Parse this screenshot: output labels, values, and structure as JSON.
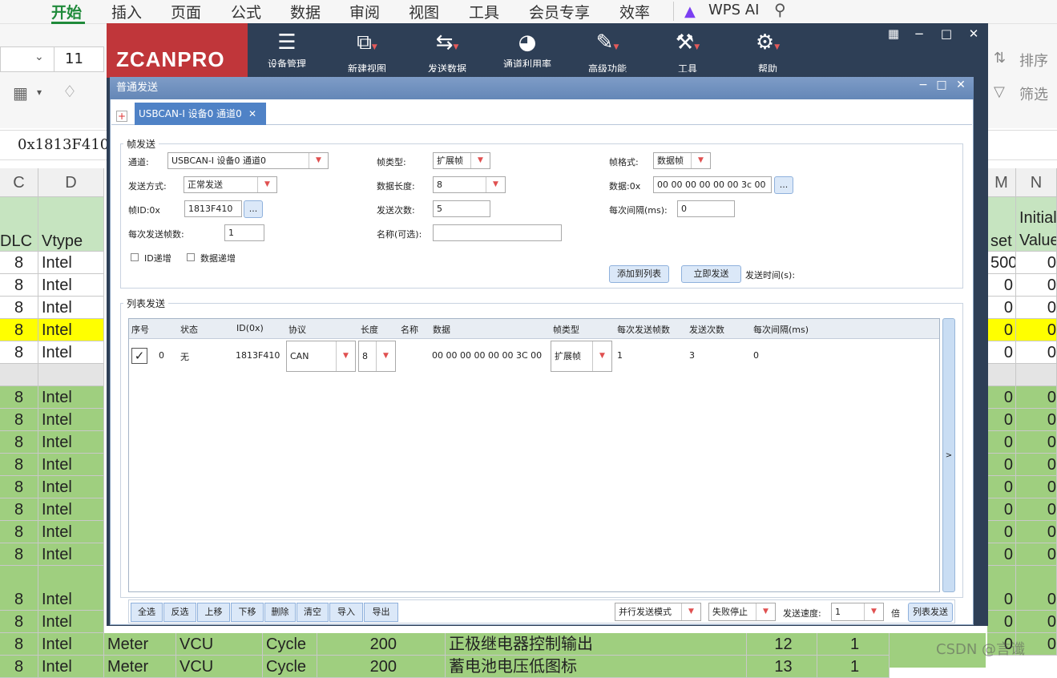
{
  "wps": {
    "menu": [
      "开始",
      "插入",
      "页面",
      "公式",
      "数据",
      "审阅",
      "视图",
      "工具",
      "会员专享",
      "效率"
    ],
    "ai_label": "WPS AI",
    "font_size": "11",
    "sort_label": "排序",
    "filter_label": "筛选",
    "formula": "0x1813F410",
    "col_headers": {
      "c": "C",
      "d": "D",
      "m": "M",
      "n": "N"
    },
    "hdr_row": {
      "c": "DLC",
      "d": "Vtype",
      "m": "set",
      "n1": "Initial",
      "n2": "Value"
    },
    "rows": [
      {
        "c": "8",
        "d": "Intel",
        "m": "500",
        "n": "0"
      },
      {
        "c": "8",
        "d": "Intel",
        "m": "0",
        "n": "0"
      },
      {
        "c": "8",
        "d": "Intel",
        "m": "0",
        "n": "0"
      },
      {
        "c": "8",
        "d": "Intel",
        "m": "0",
        "n": "0"
      },
      {
        "c": "8",
        "d": "Intel",
        "m": "0",
        "n": "0"
      },
      {
        "c": "",
        "d": "",
        "m": "",
        "n": ""
      },
      {
        "c": "8",
        "d": "Intel",
        "m": "0",
        "n": "0"
      },
      {
        "c": "8",
        "d": "Intel",
        "m": "0",
        "n": "0"
      },
      {
        "c": "8",
        "d": "Intel",
        "m": "0",
        "n": "0"
      },
      {
        "c": "8",
        "d": "Intel",
        "m": "0",
        "n": "0"
      },
      {
        "c": "8",
        "d": "Intel",
        "m": "0",
        "n": "0"
      },
      {
        "c": "8",
        "d": "Intel",
        "m": "0",
        "n": "0"
      },
      {
        "c": "8",
        "d": "Intel",
        "m": "0",
        "n": "0"
      },
      {
        "c": "8",
        "d": "Intel",
        "m": "0",
        "n": "0"
      },
      {
        "c": "8",
        "d": "Intel",
        "m": "0",
        "n": "0"
      },
      {
        "c": "8",
        "d": "Intel",
        "m": "0",
        "n": "0"
      },
      {
        "c": "8",
        "d": "Intel",
        "m": "0",
        "n": "0"
      }
    ],
    "bottom_rows": [
      {
        "e": "Meter",
        "f": "VCU",
        "g": "Cycle",
        "h": "200",
        "i": "正极继电器控制输出",
        "j": "12",
        "k": "1"
      },
      {
        "e": "Meter",
        "f": "VCU",
        "g": "Cycle",
        "h": "200",
        "i": "蓄电池电压低图标",
        "j": "13",
        "k": "1"
      }
    ],
    "watermark": "CSDN @言谶"
  },
  "zcan": {
    "logo": "ZCANPRO",
    "tools": [
      "设备管理",
      "新建视图",
      "发送数据",
      "通道利用率",
      "高级功能",
      "工具",
      "帮助"
    ],
    "tool_icons": [
      "device-manager-icon",
      "new-view-icon",
      "send-data-icon",
      "bus-load-icon",
      "advanced-icon",
      "tools-icon",
      "help-icon"
    ]
  },
  "dialog": {
    "title": "普通发送",
    "tab": "USBCAN-I 设备0 通道0",
    "frame_group": "帧发送",
    "channel_label": "通道:",
    "channel_value": "USBCAN-I 设备0 通道0",
    "frame_type_label": "帧类型:",
    "frame_type_value": "扩展帧",
    "frame_format_label": "帧格式:",
    "frame_format_value": "数据帧",
    "send_mode_label": "发送方式:",
    "send_mode_value": "正常发送",
    "data_len_label": "数据长度:",
    "data_len_value": "8",
    "data_label": "数据:0x",
    "data_value": "00 00 00 00 00 00 3c 00",
    "frame_id_label": "帧ID:0x",
    "frame_id_value": "1813F410",
    "send_count_label": "发送次数:",
    "send_count_value": "5",
    "interval_label": "每次间隔(ms):",
    "interval_value": "0",
    "frames_per_send_label": "每次发送帧数:",
    "frames_per_send_value": "1",
    "name_label": "名称(可选):",
    "name_value": "",
    "id_inc_label": "ID递增",
    "data_inc_label": "数据递增",
    "add_to_list": "添加到列表",
    "send_now": "立即发送",
    "send_time_label": "发送时间(s):",
    "ellipsis": "...",
    "list_group": "列表发送",
    "columns": [
      "序号",
      "状态",
      "ID(0x)",
      "协议",
      "长度",
      "名称",
      "数据",
      "帧类型",
      "每次发送帧数",
      "发送次数",
      "每次间隔(ms)"
    ],
    "row": {
      "index": "0",
      "status": "无",
      "id": "1813F410",
      "protocol": "CAN",
      "length": "8",
      "name": "",
      "data": "00 00 00 00 00 00 3C 00",
      "frame_type": "扩展帧",
      "frames_per_send": "1",
      "send_count": "3",
      "interval": "0"
    },
    "expand": ">",
    "bottom_buttons": [
      "全选",
      "反选",
      "上移",
      "下移",
      "删除",
      "清空",
      "导入",
      "导出"
    ],
    "parallel_mode": "并行发送模式",
    "fail_stop": "失败停止",
    "speed_label": "发送速度:",
    "speed_value": "1",
    "speed_unit": "倍",
    "list_send": "列表发送"
  }
}
